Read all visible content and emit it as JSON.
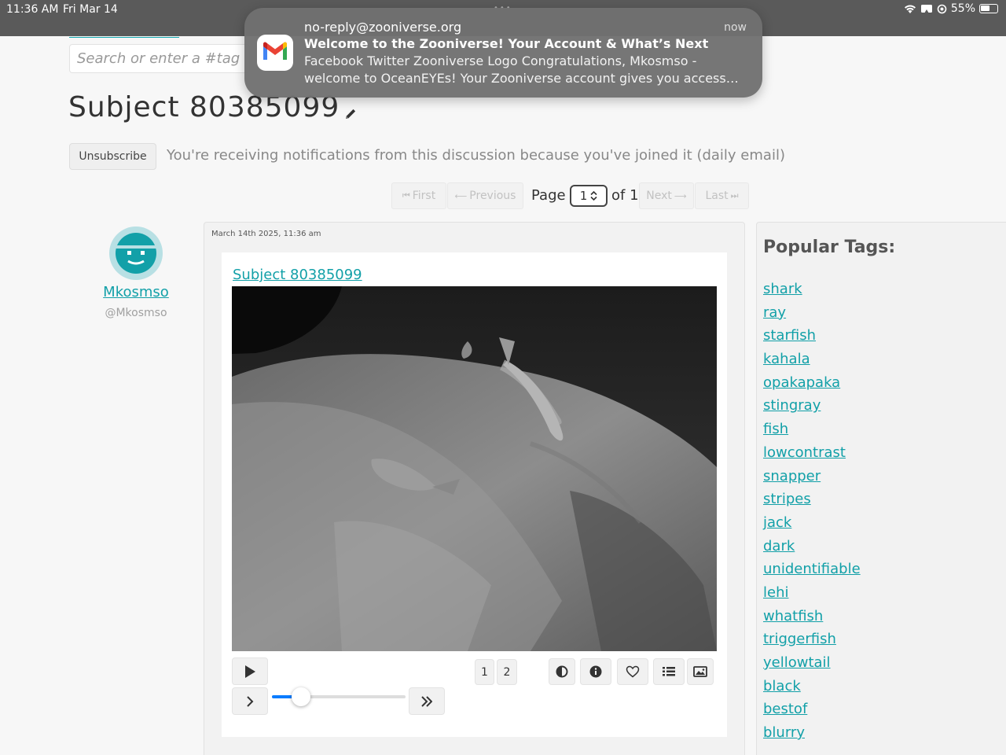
{
  "statusbar": {
    "time": "11:36 AM",
    "date": "Fri Mar 14",
    "battery": "55%",
    "icons": [
      "wifi-icon",
      "screen-mirror-icon",
      "location-icon",
      "battery-icon"
    ]
  },
  "search": {
    "placeholder": "Search or enter a #tag"
  },
  "page": {
    "title": "Subject 80385099"
  },
  "subscription": {
    "button_label": "Unsubscribe",
    "message": "You're receiving notifications from this discussion because you've joined it (daily email)"
  },
  "pagination": {
    "first": "First",
    "previous": "Previous",
    "page_label": "Page",
    "current": "1",
    "of_label": "of 1",
    "next": "Next",
    "last": "Last"
  },
  "comment": {
    "user": {
      "name": "Mkosmso",
      "handle": "@Mkosmso"
    },
    "timestamp": "March 14th 2025, 11:36 am",
    "subject_link": "Subject 80385099",
    "frames": [
      "1",
      "2"
    ],
    "slider_progress": 0.22
  },
  "tags": {
    "title": "Popular Tags:",
    "items": [
      "shark",
      "ray",
      "starfish",
      "kahala",
      "opakapaka",
      "stingray",
      "fish",
      "lowcontrast",
      "snapper",
      "stripes",
      "jack",
      "dark",
      "unidentifiable",
      "lehi",
      "whatfish",
      "triggerfish",
      "yellowtail",
      "black",
      "bestof",
      "blurry"
    ]
  },
  "notification": {
    "app_icon": "gmail-icon",
    "from": "no-reply@zooniverse.org",
    "subject": "Welcome to the Zooniverse! Your Account & What’s Next",
    "body": "Facebook Twitter Zooniverse Logo Congratulations, Mkosmso - welcome to OceanEYEs! Your Zooniverse account gives you access…",
    "time": "now"
  },
  "colors": {
    "accent": "#12a0a8",
    "slider": "#0a7cff",
    "statusbar": "#5a5a5a"
  }
}
